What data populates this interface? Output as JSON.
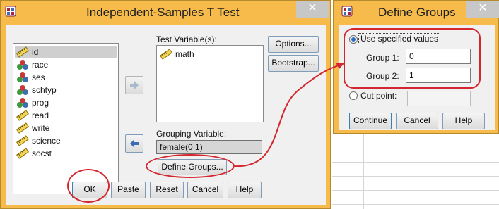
{
  "main_dialog": {
    "title": "Independent-Samples T Test",
    "close_glyph": "✕",
    "variables": [
      {
        "name": "id",
        "icon": "ruler-icon",
        "selected": true
      },
      {
        "name": "race",
        "icon": "nominal-icon"
      },
      {
        "name": "ses",
        "icon": "nominal-icon"
      },
      {
        "name": "schtyp",
        "icon": "nominal-icon"
      },
      {
        "name": "prog",
        "icon": "nominal-icon"
      },
      {
        "name": "read",
        "icon": "ruler-icon"
      },
      {
        "name": "write",
        "icon": "ruler-icon"
      },
      {
        "name": "science",
        "icon": "ruler-icon"
      },
      {
        "name": "socst",
        "icon": "ruler-icon"
      }
    ],
    "test_variables_label": "Test Variable(s):",
    "test_variables": [
      {
        "name": "math",
        "icon": "ruler-icon"
      }
    ],
    "grouping_variable_label": "Grouping Variable:",
    "grouping_variable_value": "female(0 1)",
    "define_groups_label": "Define Groups...",
    "options_label": "Options...",
    "bootstrap_label": "Bootstrap...",
    "buttons": {
      "ok": "OK",
      "paste": "Paste",
      "reset": "Reset",
      "cancel": "Cancel",
      "help": "Help"
    }
  },
  "define_dialog": {
    "title": "Define Groups",
    "close_glyph": "✕",
    "use_specified_label": "Use specified values",
    "group1_label": "Group 1:",
    "group1_value": "0",
    "group2_label": "Group 2:",
    "group2_value": "1",
    "cut_point_label": "Cut point:",
    "cut_point_value": "",
    "buttons": {
      "continue": "Continue",
      "cancel": "Cancel",
      "help": "Help"
    }
  },
  "colors": {
    "dialog_bg": "#f0f0f0",
    "frame": "#f6bb4a",
    "highlight": "#d4262e",
    "selection": "#cfcfcf"
  }
}
